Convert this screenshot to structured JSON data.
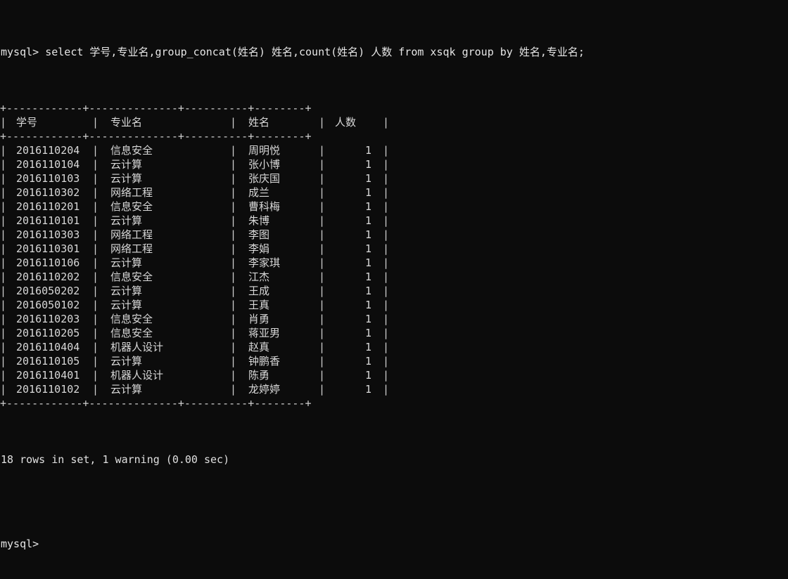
{
  "terminal": {
    "background_color": "#0c0c0c",
    "text_color": "#d8d8d8",
    "border_color": "#cfcfcf",
    "prompt": "mysql>",
    "query": "mysql> select 学号,专业名,group_concat(姓名) 姓名,count(姓名) 人数 from xsqk group by 姓名,专业名;",
    "status_line": "18 rows in set, 1 warning (0.00 sec)",
    "final_prompt": "mysql>"
  },
  "result": {
    "rule_top": "+------------+--------------+----------+--------+",
    "rule_mid": "+------------+--------------+----------+--------+",
    "rule_bottom": "+------------+--------------+----------+--------+",
    "columns": [
      "学号",
      "专业名",
      "姓名",
      "人数"
    ],
    "rows": [
      {
        "xuehao": "2016110204",
        "zhuanye": "信息安全",
        "xingming": "周明悦",
        "renshu": "1"
      },
      {
        "xuehao": "2016110104",
        "zhuanye": "云计算",
        "xingming": "张小博",
        "renshu": "1"
      },
      {
        "xuehao": "2016110103",
        "zhuanye": "云计算",
        "xingming": "张庆国",
        "renshu": "1"
      },
      {
        "xuehao": "2016110302",
        "zhuanye": "网络工程",
        "xingming": "成兰",
        "renshu": "1"
      },
      {
        "xuehao": "2016110201",
        "zhuanye": "信息安全",
        "xingming": "曹科梅",
        "renshu": "1"
      },
      {
        "xuehao": "2016110101",
        "zhuanye": "云计算",
        "xingming": "朱博",
        "renshu": "1"
      },
      {
        "xuehao": "2016110303",
        "zhuanye": "网络工程",
        "xingming": "李图",
        "renshu": "1"
      },
      {
        "xuehao": "2016110301",
        "zhuanye": "网络工程",
        "xingming": "李娟",
        "renshu": "1"
      },
      {
        "xuehao": "2016110106",
        "zhuanye": "云计算",
        "xingming": "李家琪",
        "renshu": "1"
      },
      {
        "xuehao": "2016110202",
        "zhuanye": "信息安全",
        "xingming": "江杰",
        "renshu": "1"
      },
      {
        "xuehao": "2016050202",
        "zhuanye": "云计算",
        "xingming": "王成",
        "renshu": "1"
      },
      {
        "xuehao": "2016050102",
        "zhuanye": "云计算",
        "xingming": "王真",
        "renshu": "1"
      },
      {
        "xuehao": "2016110203",
        "zhuanye": "信息安全",
        "xingming": "肖勇",
        "renshu": "1"
      },
      {
        "xuehao": "2016110205",
        "zhuanye": "信息安全",
        "xingming": "蒋亚男",
        "renshu": "1"
      },
      {
        "xuehao": "2016110404",
        "zhuanye": "机器人设计",
        "xingming": "赵真",
        "renshu": "1"
      },
      {
        "xuehao": "2016110105",
        "zhuanye": "云计算",
        "xingming": "钟鹏香",
        "renshu": "1"
      },
      {
        "xuehao": "2016110401",
        "zhuanye": "机器人设计",
        "xingming": "陈勇",
        "renshu": "1"
      },
      {
        "xuehao": "2016110102",
        "zhuanye": "云计算",
        "xingming": "龙婷婷",
        "renshu": "1"
      }
    ],
    "row_count": 18,
    "vertical_bar": "|"
  }
}
